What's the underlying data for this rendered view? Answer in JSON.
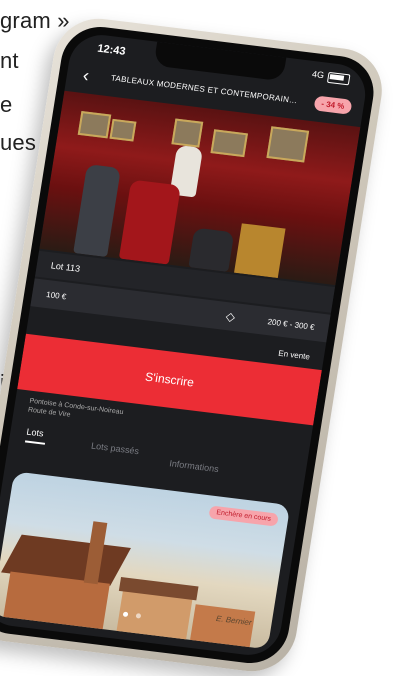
{
  "article": {
    "lines": [
      "gram »",
      "nt",
      "e",
      "ues",
      "i"
    ]
  },
  "status_bar": {
    "time": "12:43",
    "network": "4G"
  },
  "header": {
    "title": "TABLEAUX MODERNES ET CONTEMPORAINS - ART ...",
    "discount": "- 34 %"
  },
  "lot": {
    "number": "Lot 113",
    "start_price": "100 €",
    "estimate": "200 € - 300 €",
    "sale_status": "En vente"
  },
  "register_button": "S'inscrire",
  "location": {
    "line1": "Pontoise à Conde-sur-Noireau",
    "line2": "Route de Vire"
  },
  "tabs": [
    "Lots",
    "Lots passés",
    "Informations"
  ],
  "card": {
    "badge": "Enchère en cours",
    "signature": "E. Bernier"
  },
  "colors": {
    "accent": "#ec2d35",
    "badge_bg": "#f7a4ab",
    "screen_bg": "#1c1d20"
  }
}
